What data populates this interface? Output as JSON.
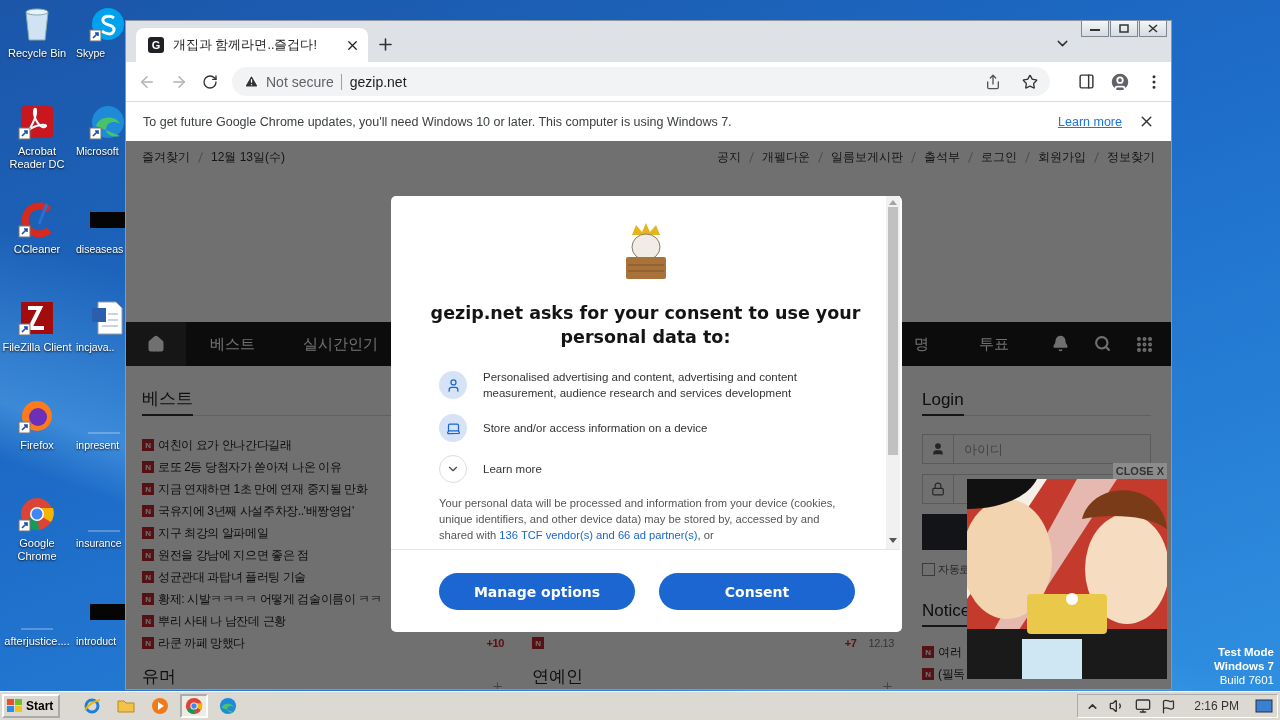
{
  "desktop": {
    "icons": [
      {
        "label": "Recycle Bin",
        "kind": "recycle",
        "shortcut": false
      },
      {
        "label": "Acrobat Reader DC",
        "kind": "acrobat",
        "shortcut": true
      },
      {
        "label": "CCleaner",
        "kind": "ccleaner",
        "shortcut": true
      },
      {
        "label": "FileZilla Client",
        "kind": "filezilla",
        "shortcut": true
      },
      {
        "label": "Firefox",
        "kind": "firefox",
        "shortcut": true
      },
      {
        "label": "Google Chrome",
        "kind": "chrome",
        "shortcut": true
      },
      {
        "label": "afterjustice....",
        "kind": "blank"
      },
      {
        "label": "Skype",
        "kind": "skype",
        "shortcut": true
      },
      {
        "label": "Microsoft",
        "kind": "edge",
        "shortcut": true
      },
      {
        "label": "diseaseas",
        "kind": "dark",
        "shortcut": false
      },
      {
        "label": "incjava..",
        "kind": "word",
        "shortcut": false
      },
      {
        "label": "inpresent",
        "kind": "blank"
      },
      {
        "label": "insurance",
        "kind": "blank"
      },
      {
        "label": "introduct",
        "kind": "dark",
        "shortcut": false
      }
    ],
    "system_notice": [
      "Test Mode",
      "Windows 7",
      "Build 7601"
    ]
  },
  "browser": {
    "tabs": [
      {
        "favicon": "G",
        "title": "개집과 함께라면..즐겁다!",
        "selected": true
      }
    ],
    "toolbar": {
      "security": "Not secure",
      "url": "gezip.net"
    },
    "infobar": {
      "message": "To get future Google Chrome updates, you'll need Windows 10 or later. This computer is using Windows 7.",
      "link": "Learn more"
    }
  },
  "page": {
    "top_left": [
      "즐겨찾기",
      "12월 13일(수)"
    ],
    "top_right": [
      "공지",
      "개펠다운",
      "일름보게시판",
      "출석부",
      "로그인",
      "회원가입",
      "정보찾기"
    ],
    "nav_left": [
      "베스트",
      "실시간인기"
    ],
    "nav_right": [
      "명",
      "투표"
    ],
    "best": {
      "title": "베스트",
      "items": [
        {
          "badge": "N",
          "title": "여친이 요가 안나간다길래"
        },
        {
          "badge": "N",
          "title": "로또 2등 당첨자가 쏟아져 나온 이유"
        },
        {
          "badge": "N",
          "title": "지금 연재하면 1초 만에 연재 중지될 만화"
        },
        {
          "badge": "N",
          "title": "국유지에 3년째 사설주차장..'배짱영업'"
        },
        {
          "badge": "N",
          "title": "지구 최강의 알파메일"
        },
        {
          "badge": "N",
          "title": "원전을 강남에 지으면 좋은 점"
        },
        {
          "badge": "N",
          "title": "성균관대 과탑녀 플러팅 기술"
        },
        {
          "badge": "N",
          "title": "황제: 시발ㅋㅋㅋㅋ 어떻게 검술이름이 ㅋㅋ"
        },
        {
          "badge": "N",
          "title": "뿌리 사태 나 남잔데 근황"
        },
        {
          "badge": "N",
          "title": "라쿤 까페 망했다",
          "count": "+10"
        }
      ]
    },
    "middle_items": [
      {
        "badge": "N",
        "count": "+7",
        "date": "12.13"
      }
    ],
    "bottom_sections": [
      "유머",
      "연예인"
    ],
    "login": {
      "title": "Login",
      "id_placeholder": "아이디",
      "auto_login": {
        "label": "자동로",
        "checked": false
      }
    },
    "notice": {
      "title": "Notice",
      "items": [
        {
          "badge": "N",
          "title": "여러"
        },
        {
          "badge": "N",
          "title": "(필독"
        }
      ]
    }
  },
  "ad": {
    "close": "CLOSE X"
  },
  "consent": {
    "title": "gezip.net asks for your consent to use your personal data to:",
    "purposes": [
      {
        "kind": "person",
        "text": "Personalised advertising and content, advertising and content measurement, audience research and services development"
      },
      {
        "kind": "device",
        "text": "Store and/or access information on a device"
      }
    ],
    "learn_more": {
      "label": "Learn more",
      "expanded": false
    },
    "text_before": "Your personal data will be processed and information from your device (cookies, unique identifiers, and other device data) may be stored by, accessed by and shared with ",
    "link": "136 TCF vendor(s) and 66 ad partner(s)",
    "text_after": ", or",
    "buttons": [
      "Manage options",
      "Consent"
    ]
  },
  "taskbar": {
    "start": "Start",
    "apps": [
      {
        "kind": "ie",
        "selected": false
      },
      {
        "kind": "folder",
        "selected": false
      },
      {
        "kind": "media",
        "selected": false
      },
      {
        "kind": "chrome",
        "selected": true
      },
      {
        "kind": "edge",
        "selected": false
      }
    ],
    "clock": "2:16 PM"
  }
}
